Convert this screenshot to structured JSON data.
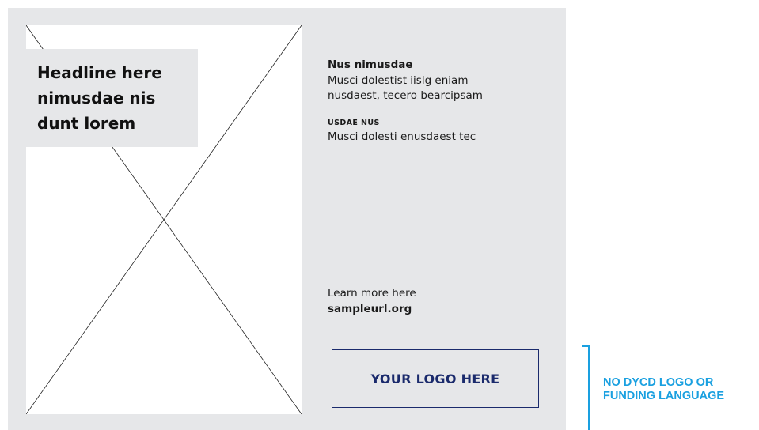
{
  "headline": {
    "line1": "Headline here",
    "line2": "nimusdae nis",
    "line3": "dunt lorem"
  },
  "details": {
    "title": "Nus nimusdae",
    "body_line1": "Musci dolestist iislg eniam",
    "body_line2": "nusdaest, tecero bearcipsam",
    "label": "USDAE NUS",
    "label_text": "Musci dolesti enusdaest tec"
  },
  "cta": {
    "text": "Learn more here",
    "url": "sampleurl.org"
  },
  "logo_placeholder": {
    "text": "YOUR LOGO HERE"
  },
  "annotation": {
    "line1": "NO DYCD LOGO OR",
    "line2": "FUNDING LANGUAGE"
  },
  "colors": {
    "panel": "#e6e7e9",
    "logo_border": "#1a2a6c",
    "annotation": "#1aa0e0"
  }
}
